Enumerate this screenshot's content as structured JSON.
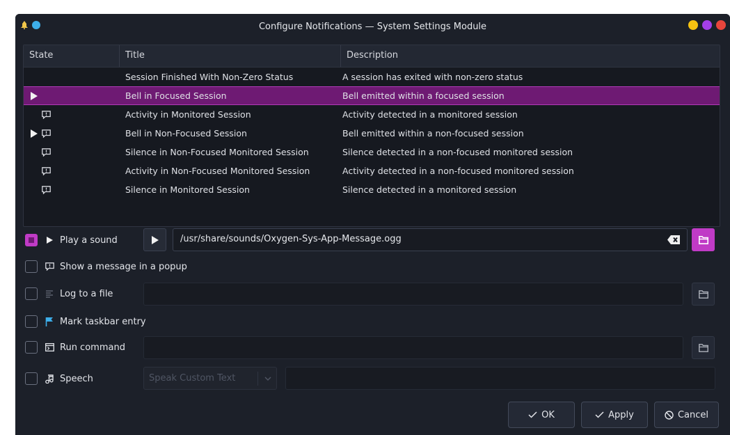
{
  "window": {
    "title": "Configure Notifications — System Settings Module"
  },
  "colors": {
    "accent": "#c03bc6",
    "selected_row": "#6e1a73",
    "background": "#1c2029"
  },
  "table": {
    "columns": [
      "State",
      "Title",
      "Description"
    ],
    "rows": [
      {
        "state": [],
        "title": "Session Finished With Non-Zero Status",
        "description": "A session has exited with non-zero status"
      },
      {
        "state": [
          "play-icon"
        ],
        "title": "Bell in Focused Session",
        "description": "Bell emitted within a focused session",
        "selected": true
      },
      {
        "state": [
          "message-icon"
        ],
        "title": "Activity in Monitored Session",
        "description": "Activity detected in a monitored session"
      },
      {
        "state": [
          "play-icon",
          "message-icon"
        ],
        "title": "Bell in Non-Focused Session",
        "description": "Bell emitted within a non-focused session"
      },
      {
        "state": [
          "message-icon"
        ],
        "title": "Silence in Non-Focused Monitored Session",
        "description": "Silence detected in a non-focused monitored session"
      },
      {
        "state": [
          "message-icon"
        ],
        "title": "Activity in Non-Focused Monitored Session",
        "description": "Activity detected in a non-focused monitored session"
      },
      {
        "state": [
          "message-icon"
        ],
        "title": "Silence in Monitored Session",
        "description": "Silence detected in a monitored session"
      }
    ]
  },
  "options": {
    "play_sound": {
      "label": "Play a sound",
      "checked": true,
      "icon": "play-icon",
      "value": "/usr/share/sounds/Oxygen-Sys-App-Message.ogg"
    },
    "popup": {
      "label": "Show a message in a popup",
      "checked": false,
      "icon": "message-icon"
    },
    "log": {
      "label": "Log to a file",
      "checked": false,
      "icon": "log-icon",
      "value": ""
    },
    "taskbar": {
      "label": "Mark taskbar entry",
      "checked": false,
      "icon": "flag-icon"
    },
    "run_command": {
      "label": "Run command",
      "checked": false,
      "icon": "terminal-icon",
      "value": ""
    },
    "speech": {
      "label": "Speech",
      "checked": false,
      "icon": "music-icon",
      "select_value": "Speak Custom Text",
      "text": ""
    }
  },
  "buttons": {
    "ok": "OK",
    "apply": "Apply",
    "cancel": "Cancel"
  }
}
